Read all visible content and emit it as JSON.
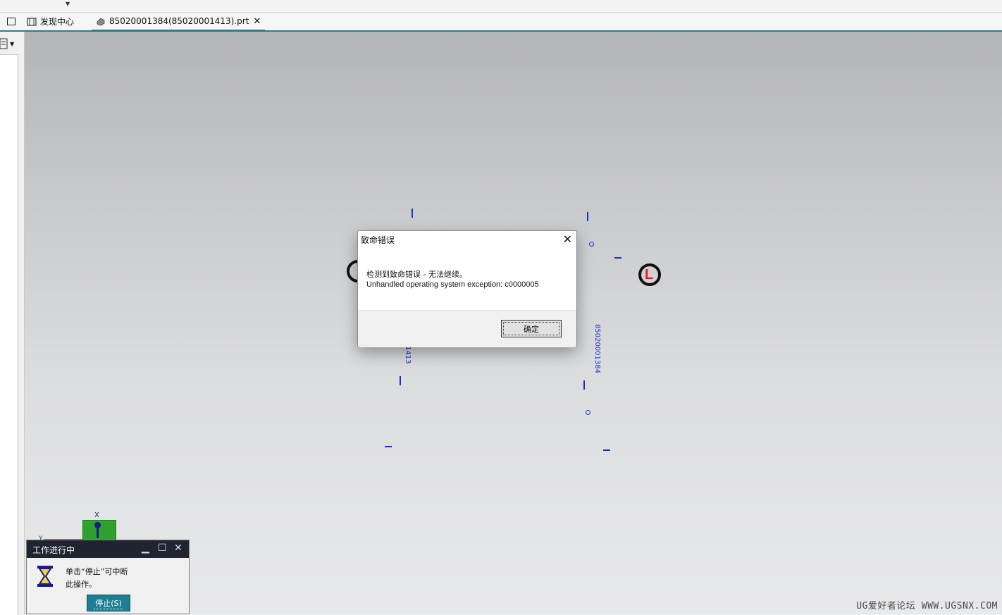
{
  "tabs": [
    {
      "label": "发现中心",
      "icon": "discovery-icon"
    },
    {
      "label": "85020001384(85020001413).prt",
      "icon": "part-file-icon"
    }
  ],
  "viewport": {
    "drawing_text_1": "85020001384",
    "drawing_text_2": "1413",
    "watermark": "UG爱好者论坛 WWW.UGSNX.COM",
    "triad_axis_x": "X",
    "triad_axis_y": "Y"
  },
  "error_dialog": {
    "title": "致命错误",
    "message_line1": "检测到致命错误 - 无法继续。",
    "message_line2": "Unhandled operating system exception: c0000005",
    "ok_label": "确定"
  },
  "progress_window": {
    "title": "工作进行中",
    "message_line1": "单击“停止”可中断",
    "message_line2": "此操作。",
    "stop_label": "停止(S)"
  },
  "colors": {
    "accent": "#2a7f8a",
    "stop_button": "#1d7f93",
    "marker_blue": "#1a2fd0",
    "datum_red": "#e81c1c"
  }
}
